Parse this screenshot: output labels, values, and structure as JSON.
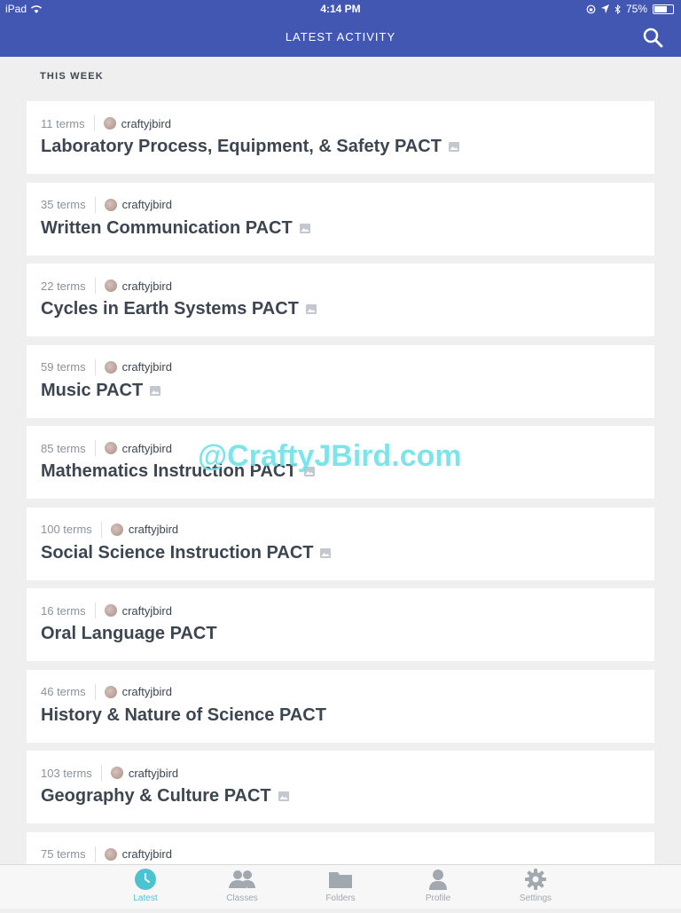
{
  "status_bar": {
    "device": "iPad",
    "time": "4:14 PM",
    "battery": "75%",
    "battery_level": 0.75
  },
  "header": {
    "title": "LATEST ACTIVITY",
    "search_icon": "search-icon"
  },
  "section": {
    "title": "THIS WEEK"
  },
  "sets": [
    {
      "terms": "11 terms",
      "user": "craftyjbird",
      "title": "Laboratory Process, Equipment, & Safety PACT",
      "has_image": true
    },
    {
      "terms": "35 terms",
      "user": "craftyjbird",
      "title": "Written Communication PACT",
      "has_image": true
    },
    {
      "terms": "22 terms",
      "user": "craftyjbird",
      "title": "Cycles in Earth Systems PACT",
      "has_image": true
    },
    {
      "terms": "59 terms",
      "user": "craftyjbird",
      "title": "Music PACT",
      "has_image": true
    },
    {
      "terms": "85 terms",
      "user": "craftyjbird",
      "title": "Mathematics Instruction PACT",
      "has_image": true
    },
    {
      "terms": "100 terms",
      "user": "craftyjbird",
      "title": "Social Science Instruction PACT",
      "has_image": true
    },
    {
      "terms": "16 terms",
      "user": "craftyjbird",
      "title": "Oral Language PACT",
      "has_image": false
    },
    {
      "terms": "46 terms",
      "user": "craftyjbird",
      "title": "History & Nature of Science PACT",
      "has_image": false
    },
    {
      "terms": "103 terms",
      "user": "craftyjbird",
      "title": "Geography & Culture PACT",
      "has_image": true
    },
    {
      "terms": "75 terms",
      "user": "craftyjbird",
      "title": "",
      "has_image": false
    }
  ],
  "watermark": "@CraftyJBird.com",
  "tabs": [
    {
      "label": "Latest",
      "icon": "clock-icon",
      "active": true
    },
    {
      "label": "Classes",
      "icon": "people-icon",
      "active": false
    },
    {
      "label": "Folders",
      "icon": "folder-icon",
      "active": false
    },
    {
      "label": "Profile",
      "icon": "person-icon",
      "active": false
    },
    {
      "label": "Settings",
      "icon": "gear-icon",
      "active": false
    }
  ],
  "colors": {
    "nav": "#4257b2",
    "accent": "#4cc3d0",
    "text": "#3d4650",
    "muted": "#8a929b"
  }
}
